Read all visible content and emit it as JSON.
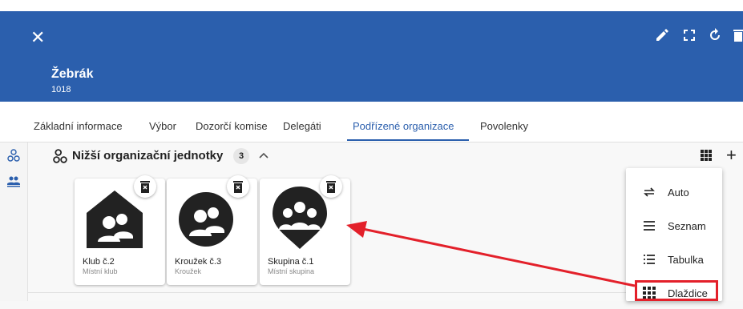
{
  "header": {
    "title": "Žebrák",
    "subtitle": "1018",
    "background": "#2b5fad"
  },
  "tabs": [
    {
      "label": "Základní informace"
    },
    {
      "label": "Výbor"
    },
    {
      "label": "Dozorčí komise"
    },
    {
      "label": "Delegáti"
    },
    {
      "label": "Podřízené organizace",
      "active": true
    },
    {
      "label": "Povolenky"
    }
  ],
  "section": {
    "title": "Nižší organizační jednotky",
    "count": "3"
  },
  "cards": [
    {
      "name": "Klub č.2",
      "type": "Místní klub",
      "icon": "house-group-icon"
    },
    {
      "name": "Kroužek č.3",
      "type": "Kroužek",
      "icon": "circle-group-icon"
    },
    {
      "name": "Skupina č.1",
      "type": "Místní skupina",
      "icon": "pin-group-icon"
    }
  ],
  "view_menu": {
    "items": [
      {
        "label": "Auto",
        "icon": "swap-icon"
      },
      {
        "label": "Seznam",
        "icon": "list-icon"
      },
      {
        "label": "Tabulka",
        "icon": "table-list-icon"
      },
      {
        "label": "Dlaždice",
        "icon": "grid-icon",
        "highlighted": true
      }
    ]
  },
  "annotation": {
    "color": "#e3202a"
  }
}
